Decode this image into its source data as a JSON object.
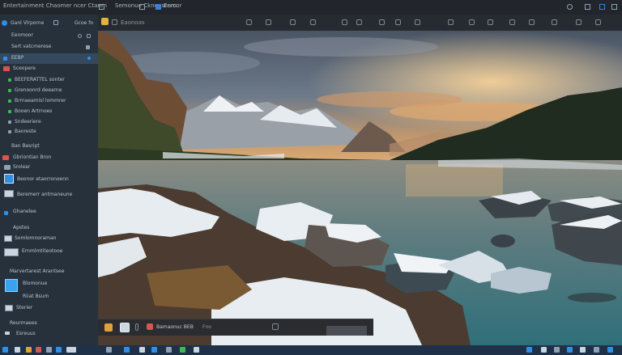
{
  "titlebar": {
    "left_text": "Entertainment Chaomer ncer Ctaren",
    "center_text": "Semonue Cknonscam",
    "right_text": "Eercor"
  },
  "sidebar": {
    "header_label": "Ganl Vlrporne",
    "tab_label": "Gcoe fo",
    "section_label": "Eenmoor",
    "folder_label": "Sert vatcmerese",
    "active_item_label": "EEBP",
    "items": [
      {
        "label": "Sceopere"
      },
      {
        "label": "BEEFERATTEL sonter"
      },
      {
        "label": "Grenoonrd deearne"
      },
      {
        "label": "Brrnaeamisl lommrer"
      },
      {
        "label": "Booen Artrnoes"
      },
      {
        "label": "Sndeeriere"
      },
      {
        "label": "Baoreste"
      }
    ],
    "group_label": "Ban Besript",
    "thumb_items": [
      {
        "label": "Gbriontian Bron"
      },
      {
        "label": "Srolear"
      },
      {
        "label": "Beonor etaorronoenn"
      },
      {
        "label": "Beremerr antmaneune"
      },
      {
        "label": "Ghanelee"
      },
      {
        "label": "Apstes"
      },
      {
        "label": "Somlomnoraman"
      },
      {
        "label": "Ernmlmtiteotooe"
      },
      {
        "label": "Marvertarest Arantsee"
      },
      {
        "label": "Blomonue"
      },
      {
        "label": "Riiat Bsum"
      },
      {
        "label": "Sterier"
      },
      {
        "label": "Reurmaees"
      },
      {
        "label": "Esreuus"
      }
    ]
  },
  "toolbar2": {
    "path_label": "Eaonoas"
  },
  "filmstrip": {
    "item_label": "Bamaonuc BEB",
    "count_label": "Fno"
  },
  "colors": {
    "sidebar_bg": "#27313c",
    "accent": "#2f8fe6",
    "taskbar_bg": "#1e3148"
  }
}
